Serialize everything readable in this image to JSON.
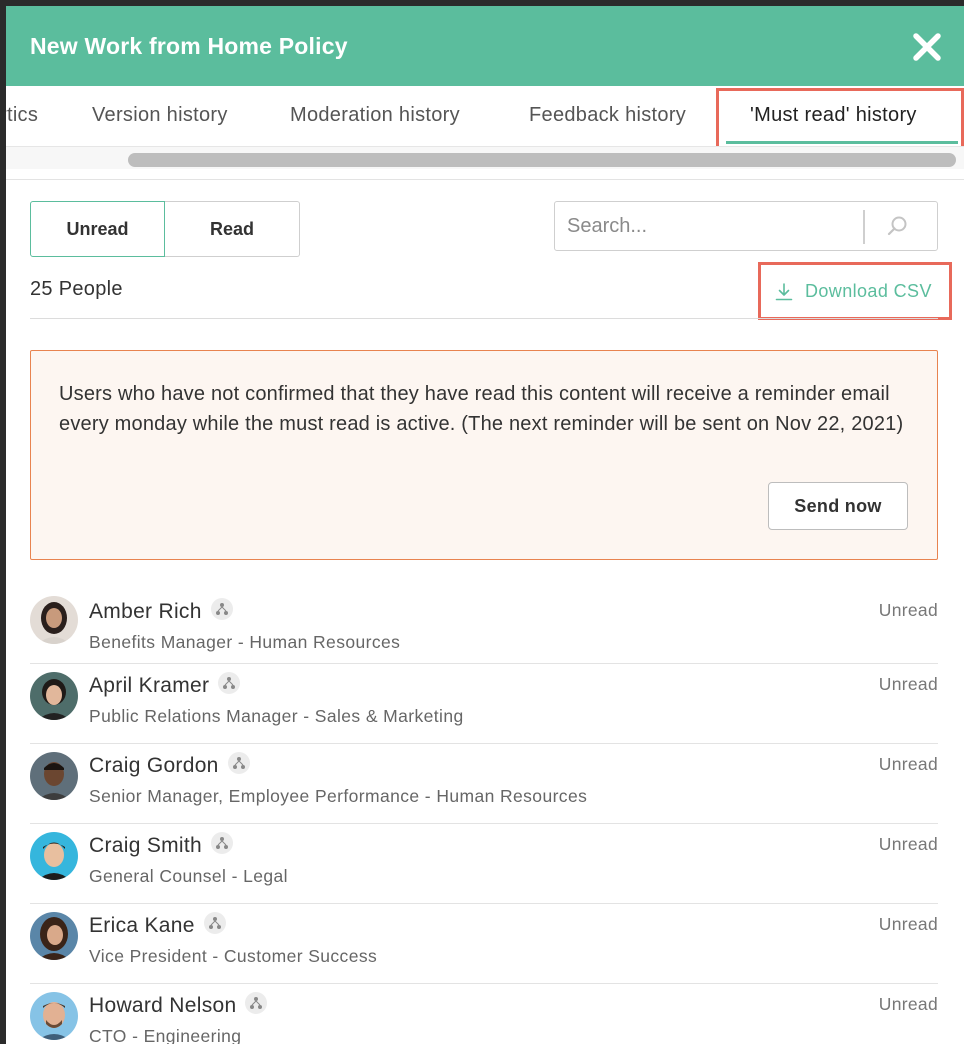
{
  "header": {
    "title": "New Work from Home Policy"
  },
  "tabs": [
    {
      "label": "Analytics",
      "visible_label": "rtics"
    },
    {
      "label": "Version history"
    },
    {
      "label": "Moderation history"
    },
    {
      "label": "Feedback history"
    },
    {
      "label": "'Must read' history",
      "active": true
    }
  ],
  "filter": {
    "unread_label": "Unread",
    "read_label": "Read",
    "selected": "Unread"
  },
  "search": {
    "placeholder": "Search..."
  },
  "summary": {
    "people_count": "25 People",
    "download_label": "Download CSV"
  },
  "notice": {
    "text": "Users who have not confirmed that they have read this content will receive a reminder email every monday while the must read is active. (The next reminder will be sent on Nov 22, 2021)",
    "send_label": "Send now"
  },
  "people": [
    {
      "name": "Amber Rich",
      "title": "Benefits Manager",
      "department": "Human Resources",
      "status": "Unread"
    },
    {
      "name": "April Kramer",
      "title": "Public Relations Manager",
      "department": "Sales & Marketing",
      "status": "Unread"
    },
    {
      "name": "Craig Gordon",
      "title": "Senior Manager, Employee Performance",
      "department": "Human Resources",
      "status": "Unread"
    },
    {
      "name": "Craig Smith",
      "title": "General Counsel",
      "department": "Legal",
      "status": "Unread"
    },
    {
      "name": "Erica Kane",
      "title": "Vice President",
      "department": "Customer Success",
      "status": "Unread"
    },
    {
      "name": "Howard Nelson",
      "title": "CTO",
      "department": "Engineering",
      "status": "Unread"
    }
  ],
  "colors": {
    "accent": "#5bbd9d",
    "highlight": "#e8695a",
    "notice_border": "#e8834f",
    "notice_bg": "#fdf6f1"
  },
  "icons": {
    "close": "close-icon",
    "search": "search-icon",
    "download": "download-icon",
    "org": "org-chart-icon"
  }
}
